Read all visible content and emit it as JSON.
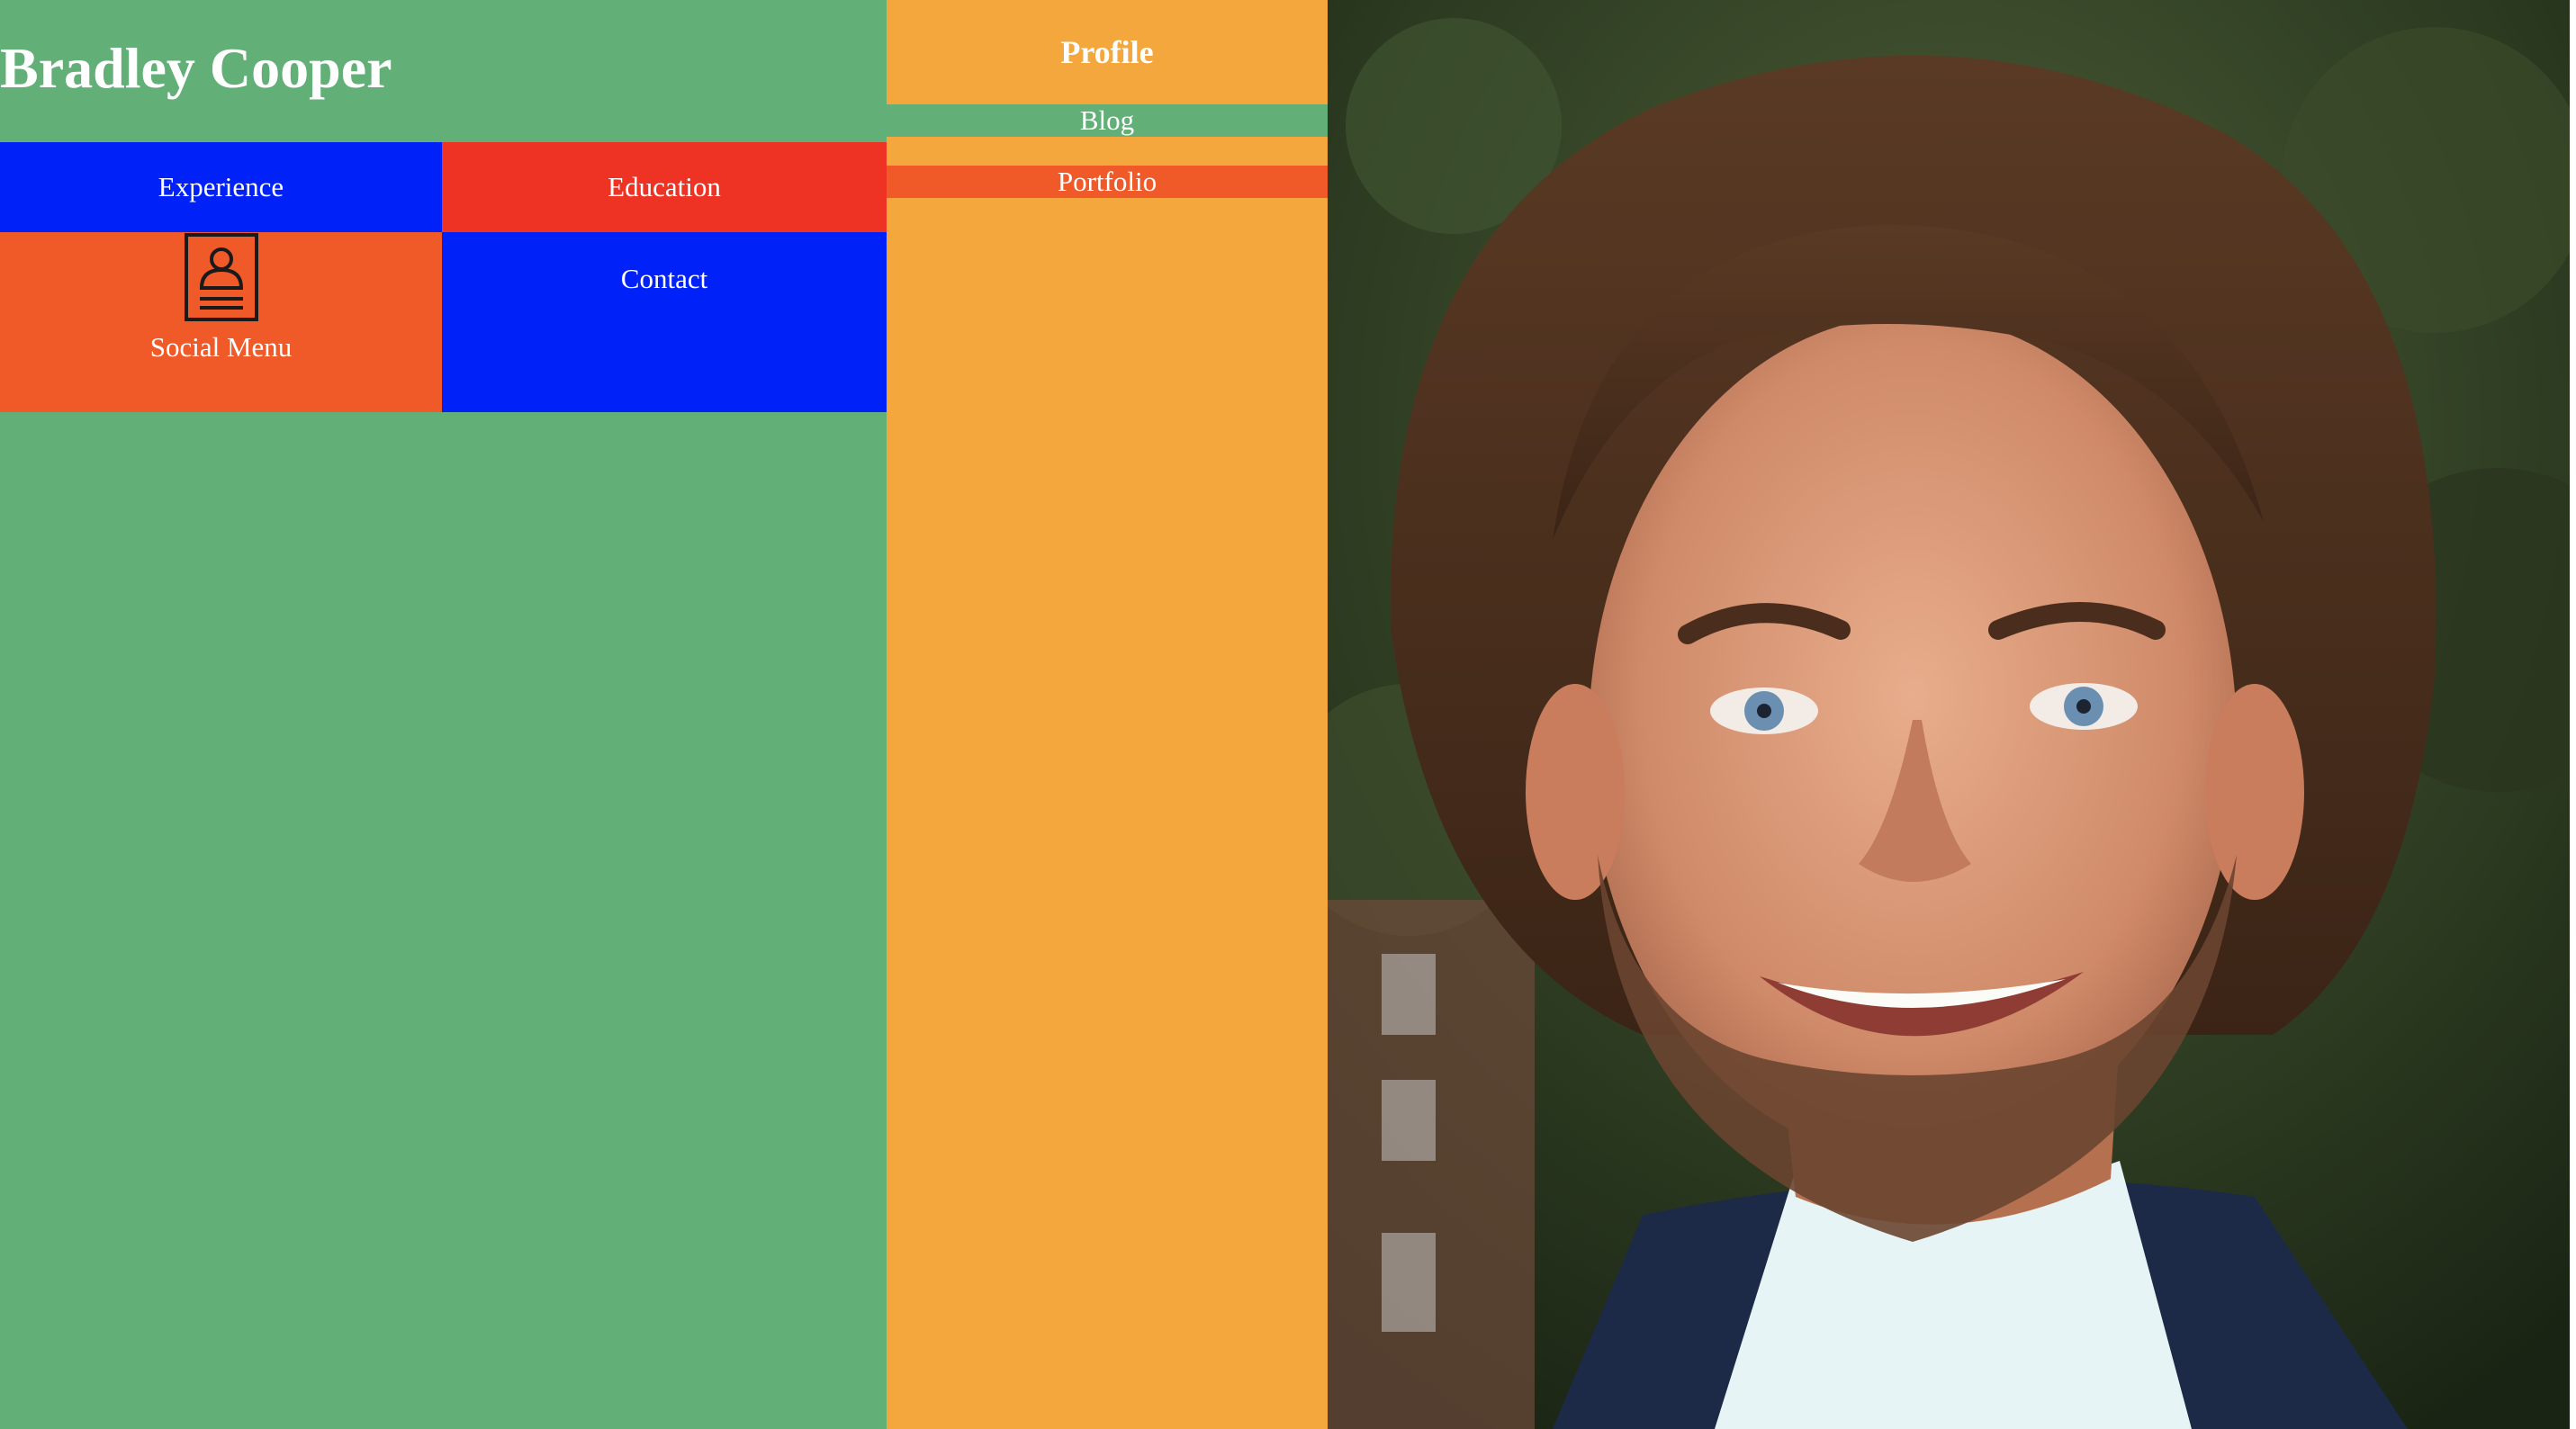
{
  "header": {
    "title": "Bradley Cooper"
  },
  "nav": {
    "experience_label": "Experience",
    "education_label": "Education",
    "social_menu_label": "Social Menu",
    "contact_label": "Contact"
  },
  "side_menu": {
    "profile_label": "Profile",
    "blog_label": "Blog",
    "portfolio_label": "Portfolio"
  },
  "colors": {
    "green": "#62b077",
    "blue": "#0022f8",
    "red": "#ee3224",
    "orange_red": "#ef5a28",
    "orange": "#f3a73d"
  },
  "icons": {
    "social_menu_icon": "profile-card-icon"
  }
}
